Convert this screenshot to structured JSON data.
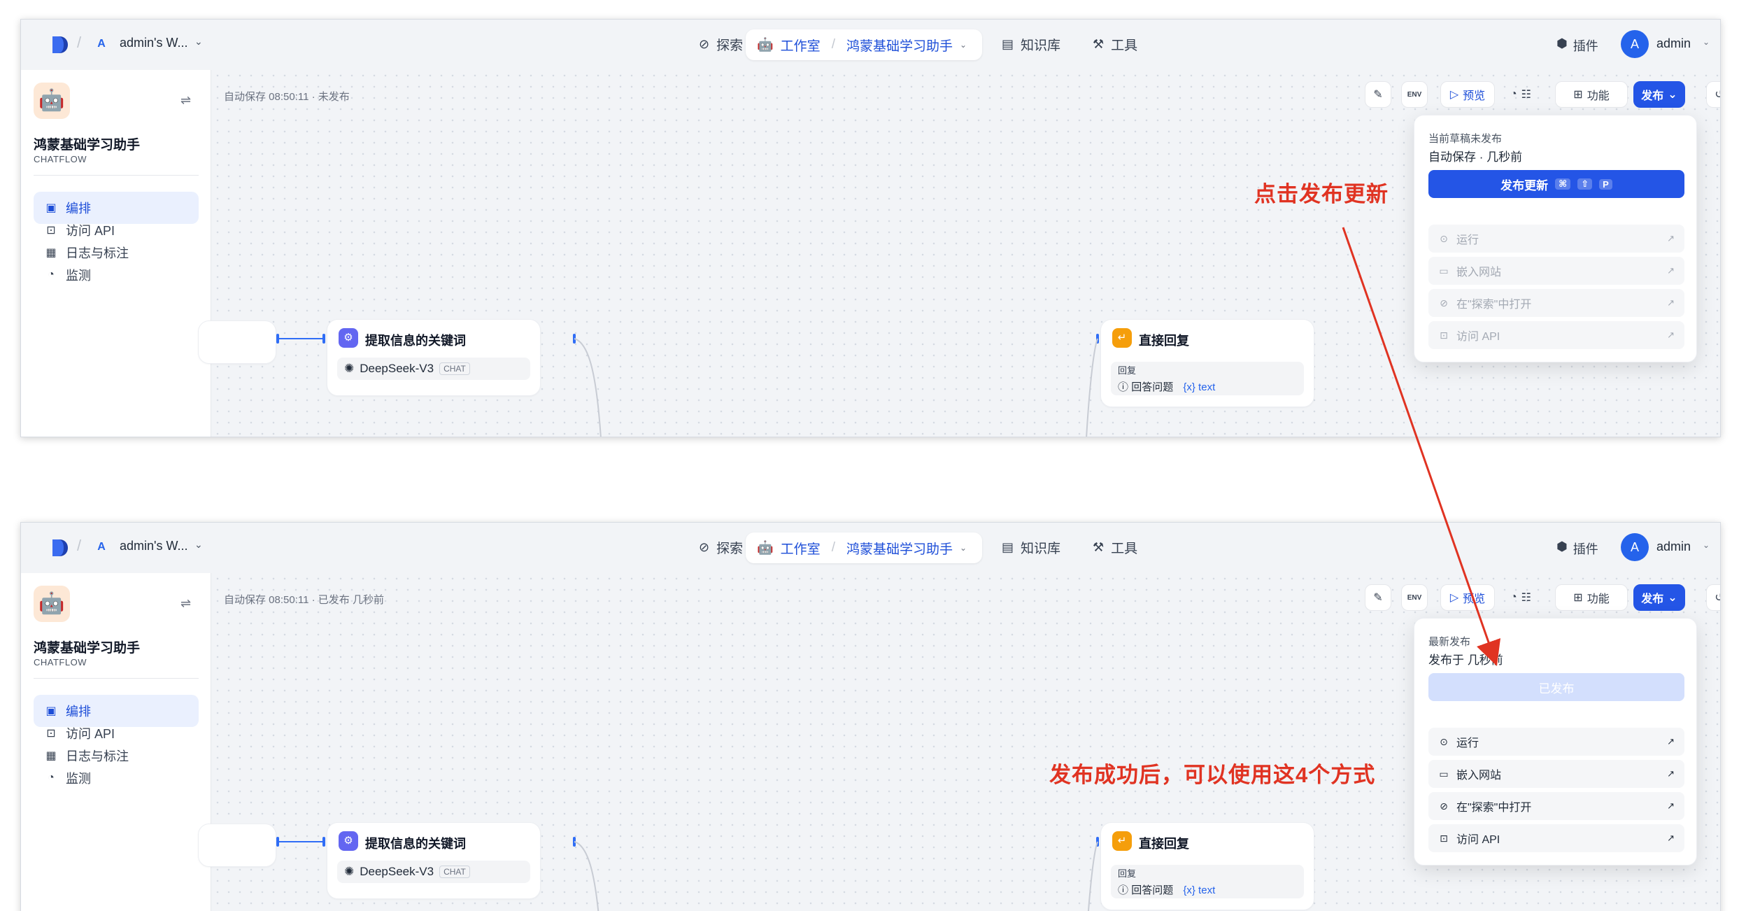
{
  "nav": {
    "workspace_badge": "A",
    "workspace_name": "admin's W...",
    "explore": "探索",
    "studio": "工作室",
    "app_name": "鸿蒙基础学习助手",
    "knowledge": "知识库",
    "tools": "工具",
    "plugin": "插件",
    "avatar_letter": "A",
    "user": "admin"
  },
  "sidebar": {
    "app_name": "鸿蒙基础学习助手",
    "app_type": "CHATFLOW",
    "items": [
      {
        "label": "编排",
        "icon": "layout-icon"
      },
      {
        "label": "访问 API",
        "icon": "terminal-icon"
      },
      {
        "label": "日志与标注",
        "icon": "log-icon"
      },
      {
        "label": "监测",
        "icon": "gauge-icon"
      }
    ]
  },
  "toolbar": {
    "env": "ENV",
    "preview": "预览",
    "features": "功能",
    "publish": "发布"
  },
  "nodes": {
    "llm_title": "提取信息的关键词",
    "model": "DeepSeek-V3",
    "model_tag": "CHAT",
    "answer_title": "直接回复",
    "answer_label": "回复",
    "answer_field": "回答问题",
    "answer_var": "{x} text"
  },
  "panel_top": {
    "autosave": "自动保存 08:50:11 · 未发布",
    "dropdown": {
      "label": "当前草稿未发布",
      "value": "自动保存 · 几秒前",
      "button": "发布更新",
      "shortcut": [
        "⌘",
        "⇧",
        "P"
      ],
      "items": [
        "运行",
        "嵌入网站",
        "在\"探索\"中打开",
        "访问 API"
      ]
    }
  },
  "panel_bottom": {
    "autosave": "自动保存 08:50:11 · 已发布 几秒前",
    "dropdown": {
      "label": "最新发布",
      "value": "发布于 几秒前",
      "button": "已发布",
      "items": [
        "运行",
        "嵌入网站",
        "在\"探索\"中打开",
        "访问 API"
      ]
    }
  },
  "annotations": {
    "click_publish": "点击发布更新",
    "after_publish": "发布成功后，可以使用这4个方式"
  },
  "colors": {
    "accent": "#2455e6",
    "annotation": "#e03322"
  }
}
